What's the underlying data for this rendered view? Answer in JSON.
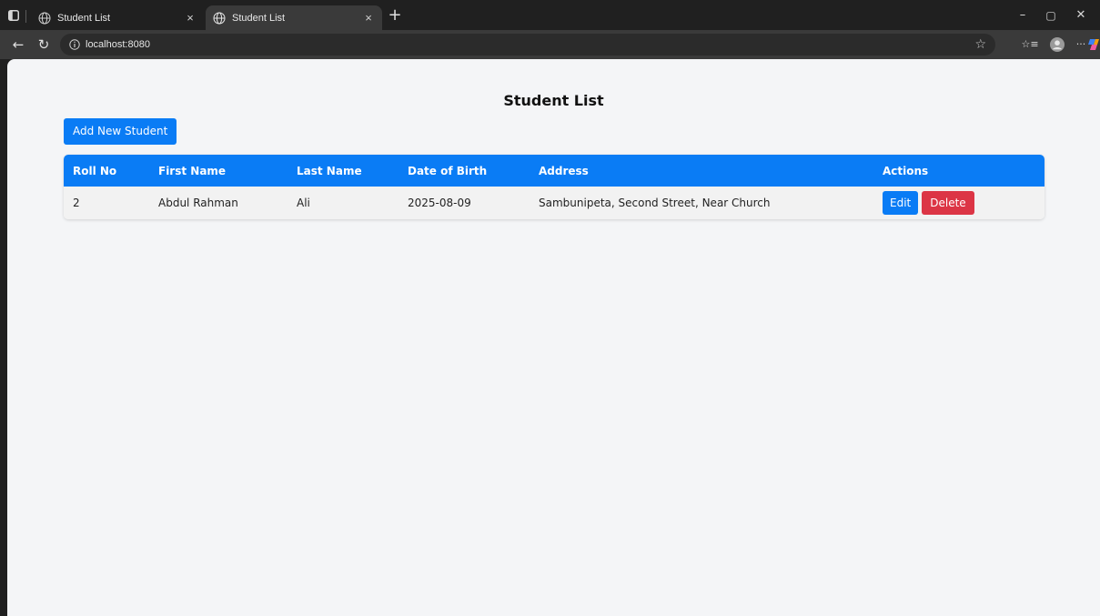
{
  "browser": {
    "tabs": [
      {
        "title": "Student List",
        "active": false
      },
      {
        "title": "Student List",
        "active": true
      }
    ],
    "url": "localhost:8080",
    "icons": {
      "sidebar": "sidebar-icon",
      "back": "back-arrow-icon",
      "refresh": "refresh-icon",
      "info": "info-icon",
      "favorite": "star-icon",
      "favorites_list": "favorites-icon",
      "profile": "profile-icon",
      "more": "more-icon",
      "copilot": "copilot-icon"
    },
    "glyphs": {
      "close": "×",
      "new_tab": "+",
      "minimize": "–",
      "maximize": "▢",
      "window_close": "✕",
      "back": "←",
      "refresh": "↻",
      "star": "☆",
      "favorites": "☆≡",
      "more": "···"
    }
  },
  "page": {
    "title": "Student List",
    "add_button": "Add New Student",
    "accent_color": "#0a7cf5",
    "danger_color": "#dc3545",
    "table": {
      "headers": [
        "Roll No",
        "First Name",
        "Last Name",
        "Date of Birth",
        "Address",
        "Actions"
      ],
      "rows": [
        {
          "roll_no": "2",
          "first_name": "Abdul Rahman",
          "last_name": "Ali",
          "dob": "2025-08-09",
          "address": "Sambunipeta, Second Street, Near Church",
          "edit_label": "Edit",
          "delete_label": "Delete"
        }
      ]
    }
  }
}
